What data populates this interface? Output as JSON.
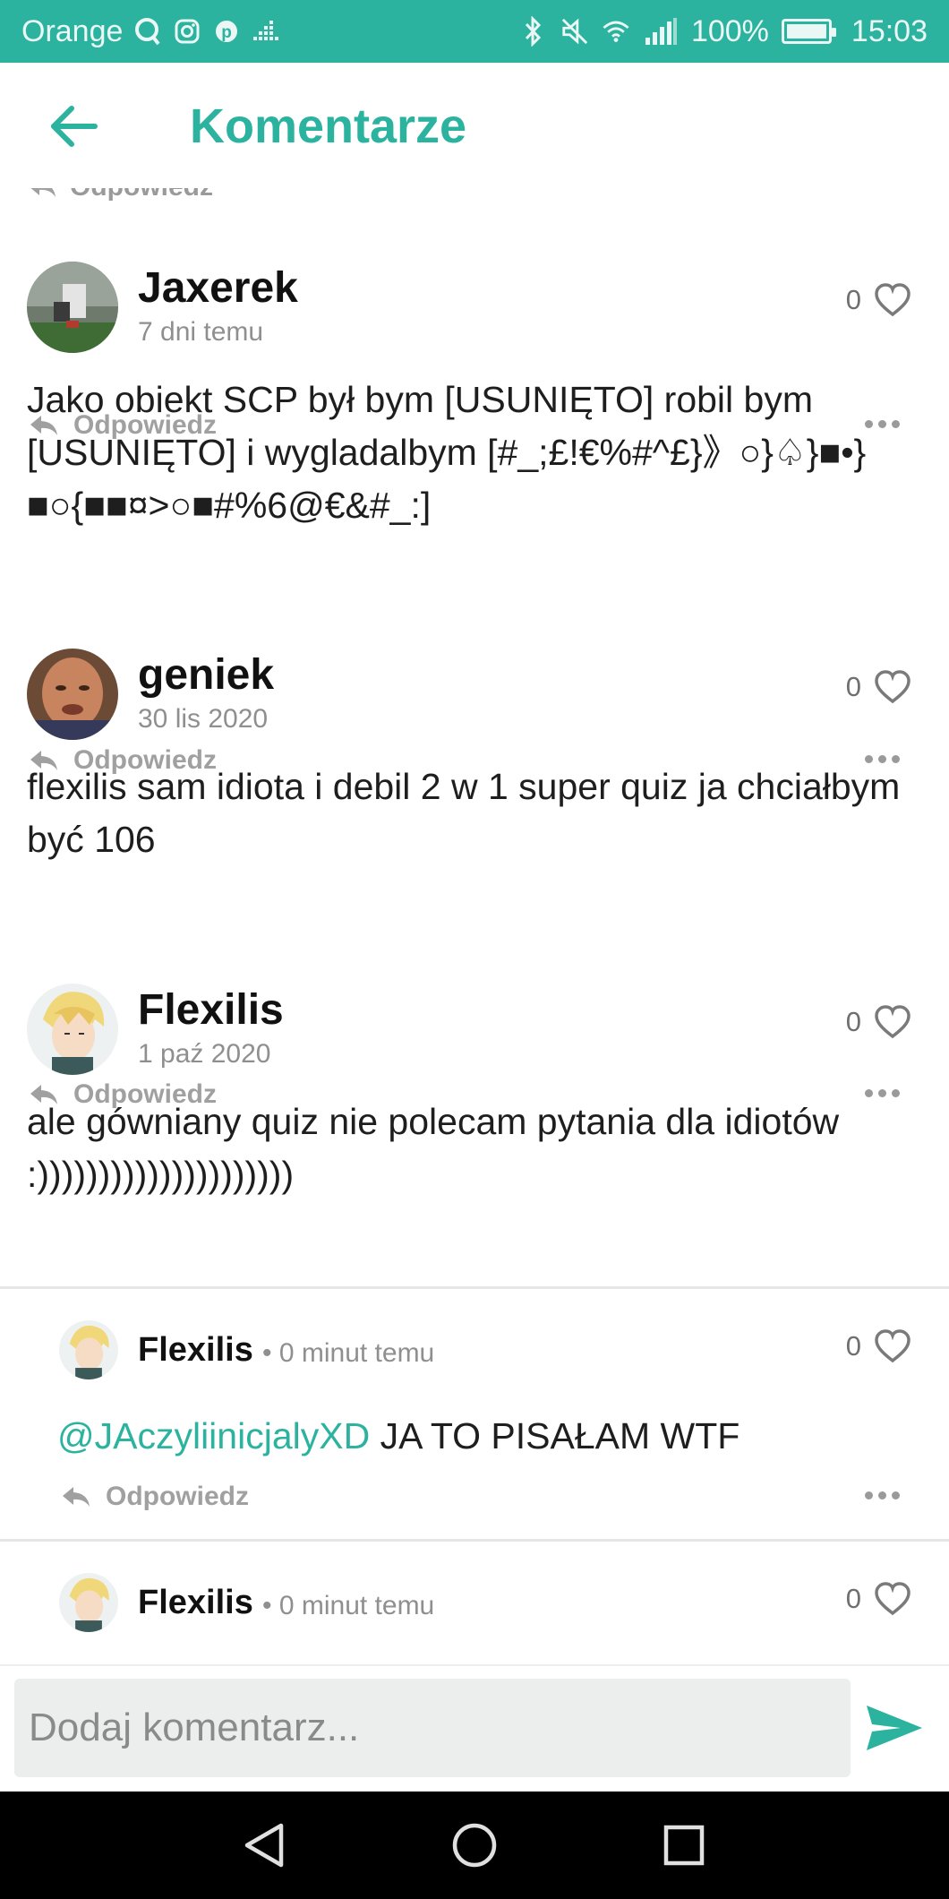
{
  "status_bar": {
    "carrier": "Orange",
    "battery": "100%",
    "battery_level": 1.0,
    "time": "15:03",
    "icons": [
      "q-icon",
      "instagram-icon",
      "pinterest-icon",
      "dotted-bars-icon",
      "bluetooth-icon",
      "mute-icon",
      "wifi-icon",
      "signal-icon",
      "battery-icon"
    ]
  },
  "header": {
    "title": "Komentarze",
    "back_icon": "arrow-left-icon"
  },
  "partial_reply": {
    "label": "Odpowiedz"
  },
  "comments": [
    {
      "author": "Jaxerek",
      "time": "7 dni temu",
      "likes": "0",
      "text": "Jako obiekt SCP był bym [USUNIĘTO] robil bym [USUNIĘTO] i wygladalbym [#_;£!€%#^£}》○}♤}■•}■○{■■¤>○■#%6@€&#_:]",
      "reply_label": "Odpowiedz"
    },
    {
      "author": "geniek",
      "time": "30 lis 2020",
      "likes": "0",
      "text": "flexilis sam idiota i debil 2 w 1 super quiz ja chciałbym być 106",
      "reply_label": "Odpowiedz"
    },
    {
      "author": "Flexilis",
      "time": "1 paź 2020",
      "likes": "0",
      "text": "ale gówniany quiz nie polecam pytania dla idiotów :)))))))))))))))))))))",
      "reply_label": "Odpowiedz"
    }
  ],
  "replies": [
    {
      "author": "Flexilis",
      "time": "• 0 minut temu",
      "likes": "0",
      "mention": "@JAczyliinicjalyXD",
      "text": " JA TO PISAŁAM WTF",
      "reply_label": "Odpowiedz"
    },
    {
      "author": "Flexilis",
      "time": "• 0 minut temu",
      "likes": "0"
    }
  ],
  "composer": {
    "placeholder": "Dodaj komentarz...",
    "send_icon": "send-icon"
  },
  "colors": {
    "accent": "#2bb3a0",
    "status_bar": "#2bb3a0",
    "nav_bar": "#000000",
    "muted": "#9a9a9a"
  }
}
